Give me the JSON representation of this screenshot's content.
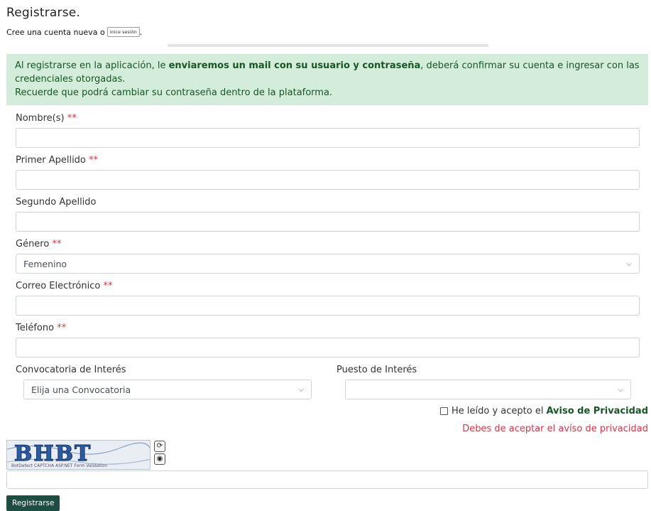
{
  "header": {
    "title": "Registrarse.",
    "subtitle_prefix": "Cree una cuenta nueva o",
    "login_label": "inice sesión",
    "subtitle_suffix": "."
  },
  "alert": {
    "line1_prefix": "Al registrarse en la aplicación, le",
    "line1_bold": "enviaremos un mail con su usuario y contraseña",
    "line1_suffix": ", deberá confirmar su cuenta e ingresar con las credenciales otorgadas.",
    "line2": "Recuerde que podrá cambiar su contraseña dentro de la plataforma."
  },
  "form": {
    "nombre_label": "Nombre(s)",
    "primer_apellido_label": "Primer Apellido",
    "segundo_apellido_label": "Segundo Apellido",
    "genero_label": "Género",
    "genero_value": "Femenino",
    "correo_label": "Correo Electrónico",
    "telefono_label": "Teléfono",
    "convocatoria_label": "Convocatoria de Interés",
    "convocatoria_value": "Elija una Convocatoria",
    "puesto_label": "Puesto de Interés",
    "puesto_value": "",
    "required_marker": "**"
  },
  "privacy": {
    "prefix": "He leído y acepto el",
    "link": "Aviso de Privacidad",
    "error": "Debes de aceptar el avíso de privacidad"
  },
  "captcha": {
    "code": "BHBT",
    "caption": "BotDetect CAPTCHA ASP.NET Form Validation"
  },
  "submit_label": "Registrarse",
  "icons": {
    "reload": "reload-icon",
    "sound": "sound-icon",
    "chevron": "chevron-down-icon"
  },
  "colors": {
    "alert_bg": "#d4edda",
    "alert_text": "#155724",
    "required": "#dc3545",
    "submit_bg": "#1d4d43"
  }
}
